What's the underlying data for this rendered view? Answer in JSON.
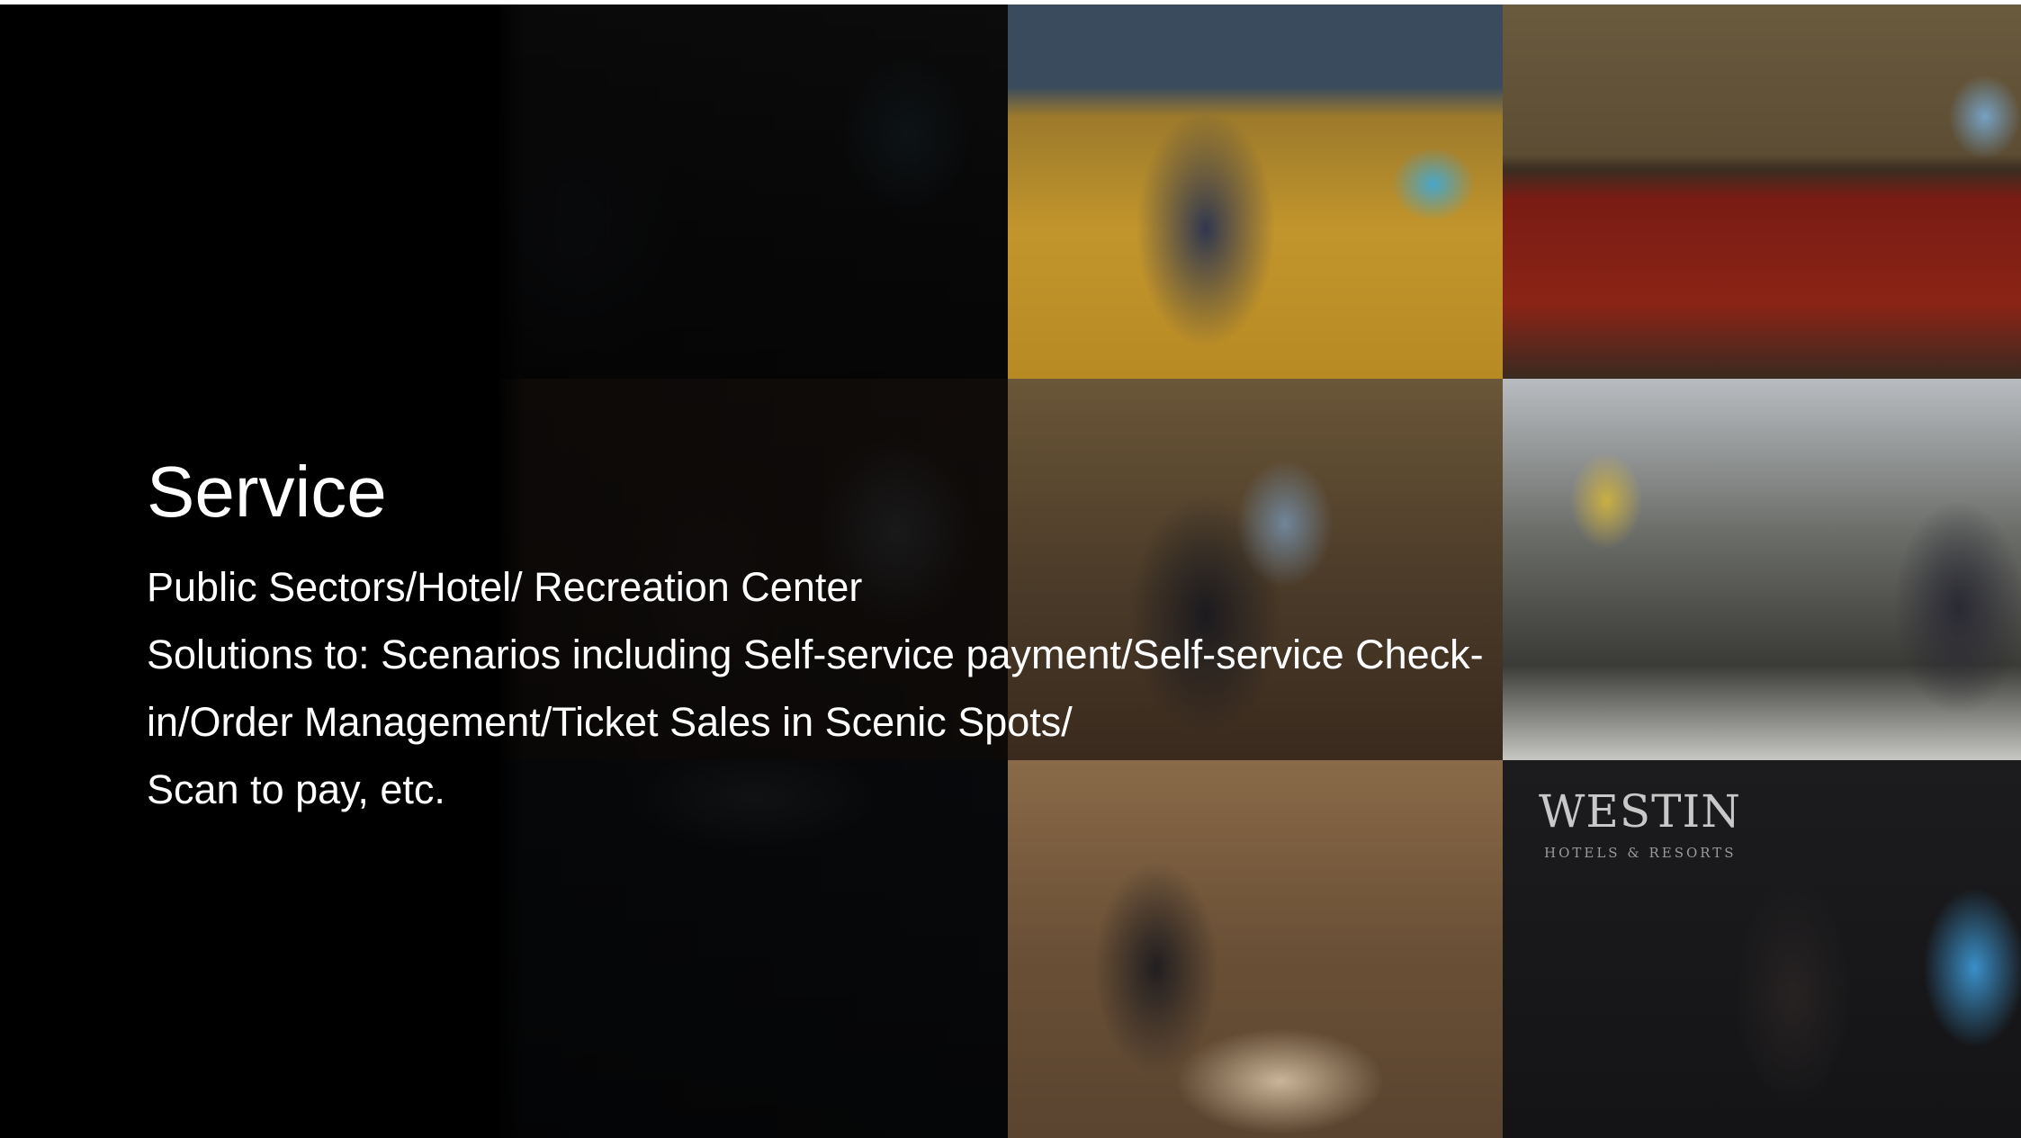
{
  "slide": {
    "title": "Service",
    "subtitle": "Public Sectors/Hotel/ Recreation Center",
    "body_lines": [
      "Solutions to: Scenarios including Self-service payment/Self-service Check-",
      "in/Order Management/Ticket Sales in Scenic Spots/",
      "Scan to pay, etc."
    ]
  },
  "photos": {
    "westin_logo": "WESTIN",
    "westin_logo_sub": "HOTELS & RESORTS"
  }
}
